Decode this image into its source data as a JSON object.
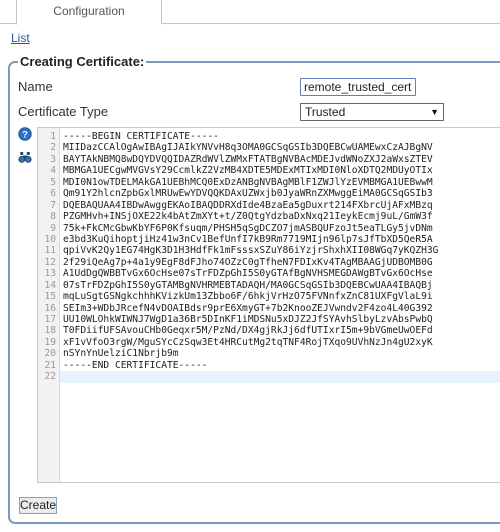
{
  "tabs": [
    {
      "label": "Configuration"
    }
  ],
  "breadcrumb": {
    "label": "List"
  },
  "form": {
    "legend": "Creating Certificate:",
    "name_label": "Name",
    "name_value": "remote_trusted_cert",
    "type_label": "Certificate Type",
    "type_value": "Trusted",
    "create_label": "Create"
  },
  "editor": {
    "lines": [
      "-----BEGIN CERTIFICATE-----",
      "MIIDazCCAlOgAwIBAgIJAIkYNVvH8q3OMA0GCSqGSIb3DQEBCwUAMEwxCzAJBgNV",
      "BAYTAkNBMQ8wDQYDVQQIDAZRdWVlZWMxFTATBgNVBAcMDEJvdWNoZXJ2aWxsZTEV",
      "MBMGA1UECgwMVGVsY29CcmlkZ2VzMB4XDTE5MDExMTIxMDI0NloXDTQ2MDUyOTIx",
      "MDI0N1owTDELMAkGA1UEBhMCQ0ExDzANBgNVBAgMBlF1ZWJlYzEVMBMGA1UEBwwM",
      "Qm91Y2hlcnZpbGxlMRUwEwYDVQQKDAxUZWxjb0JyaWRnZXMwggEiMA0GCSqGSIb3",
      "DQEBAQUAA4IBDwAwggEKAoIBAQDDRXdIde4BzaEa5gDuxrt214FXbrcUjAFxMBzq",
      "PZGMHvh+INSjOXE22k4bAtZmXYt+t/Z0QtgYdzbaDxNxq21IeykEcmj9uL/GmW3f",
      "75k+FkCMcGbwKbYF6P0Kfsuqm/PHSH5qSgDCZO7jmASBQUFzoJt5eaTLGy5jvDNm",
      "e3bd3KuQihoptjiHz41w3nCv1BefUnfI7kB9Rm7719MIjn96lp7sJfTbXD5QeR5A",
      "qpiVvK2Qy1EG74HgK3D1H3HdfFk1mFsssxSZuY86iYzjrShxhXII08WGq7yKQZH3G",
      "2f29iQeAg7p+4a1y9EgF8dFJho74OZzC0gTfheN7FDIxKv4TAgMBAAGjUDBOMB0G",
      "A1UdDgQWBBTvGx6OcHse07sTrFDZpGhI5S0yGTAfBgNVHSMEGDAWgBTvGx6OcHse",
      "07sTrFDZpGhI5S0yGTAMBgNVHRMEBTADAQH/MA0GCSqGSIb3DQEBCwUAA4IBAQBj",
      "mqLuSgtGSNgkchhhKVizkUm13Zbbo6F/6hkjVrHzO75FVNnfxZnC81UXFgVlaL9i",
      "SEIm3+WDbJRcefN4vDOAIBdsr9prE6XmyGT+7b2KnooZEJVwndv2F4zo4L40G392",
      "UU10WLOhkWIWNJ7WgD1a36Br5DInKF1iMDSNu5xDJZ2JfSYAvhSlbyLzvAbsPwbQ",
      "T0FDiifUFSAvouCHb0Geqxr5M/PzNd/DX4gjRkJj6dfUTIxrI5m+9bVGmeUwOEFd",
      "xF1vVfoO3rgW/MguSYcCzSqw3Et4HRCutMg2tqTNF4RojTXqo9UVhNzJn4gU2xyK",
      "nSYnYnUelziC1Nbrjb9m",
      "-----END CERTIFICATE-----",
      ""
    ],
    "active_line": 22
  },
  "icons": {
    "help": "help-icon",
    "find": "binoculars-icon"
  },
  "colors": {
    "accent": "#7a9ac2",
    "link": "#2456a8",
    "active_line": "#e8f2fe"
  }
}
